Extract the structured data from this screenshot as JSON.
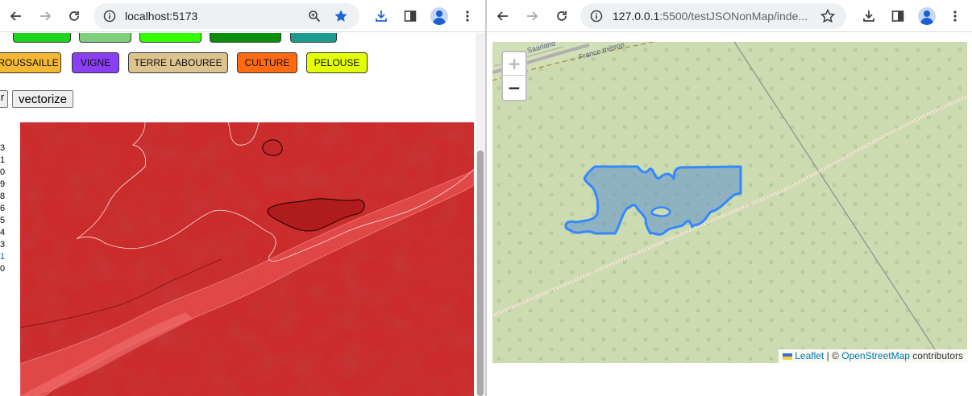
{
  "left_window": {
    "url": "localhost:5173",
    "nav_icons": [
      "back-arrow-icon",
      "forward-arrow-icon",
      "reload-icon"
    ],
    "omnibox_icons": [
      "site-info-icon",
      "zoom-icon",
      "bookmark-star-icon"
    ],
    "toolbar_icons": [
      "download-icon",
      "side-panel-icon",
      "profile-icon",
      "more-menu-icon"
    ],
    "class_buttons_row1": [
      {
        "label": "",
        "color": "#1fd41f"
      },
      {
        "label": "",
        "color": "#7fd17f"
      },
      {
        "label": "",
        "color": "#33ff00"
      },
      {
        "label": "",
        "color": "#0a8f0a"
      },
      {
        "label": "",
        "color": "#1c9c8c"
      }
    ],
    "class_buttons_row2": [
      {
        "label": "ROUSSAILLE",
        "color": "#f5b833"
      },
      {
        "label": "VIGNE",
        "color": "#8a3ff2"
      },
      {
        "label": "TERRE LABOUREE",
        "color": "#dcc48f"
      },
      {
        "label": "CULTURE",
        "color": "#ff6a13"
      },
      {
        "label": "PELOUSE",
        "color": "#e4ff00"
      }
    ],
    "stub_button_label": "r",
    "vectorize_label": "vectorize",
    "side_numbers": [
      "3",
      "1",
      "0",
      "9",
      "8",
      "6",
      "5",
      "4",
      "3",
      "1",
      "0"
    ]
  },
  "right_window": {
    "url_host": "127.0.0.1",
    "url_path": ":5500/testJSONonMap/inde...",
    "nav_icons": [
      "back-arrow-icon",
      "forward-arrow-icon",
      "reload-icon"
    ],
    "zoom_in_label": "+",
    "zoom_out_label": "−",
    "map_labels": [
      "Saarland",
      "France métrop"
    ],
    "attribution_link1": "Leaflet",
    "attribution_sep": "| ©",
    "attribution_link2": "OpenStreetMap",
    "attribution_tail": "contributors"
  }
}
